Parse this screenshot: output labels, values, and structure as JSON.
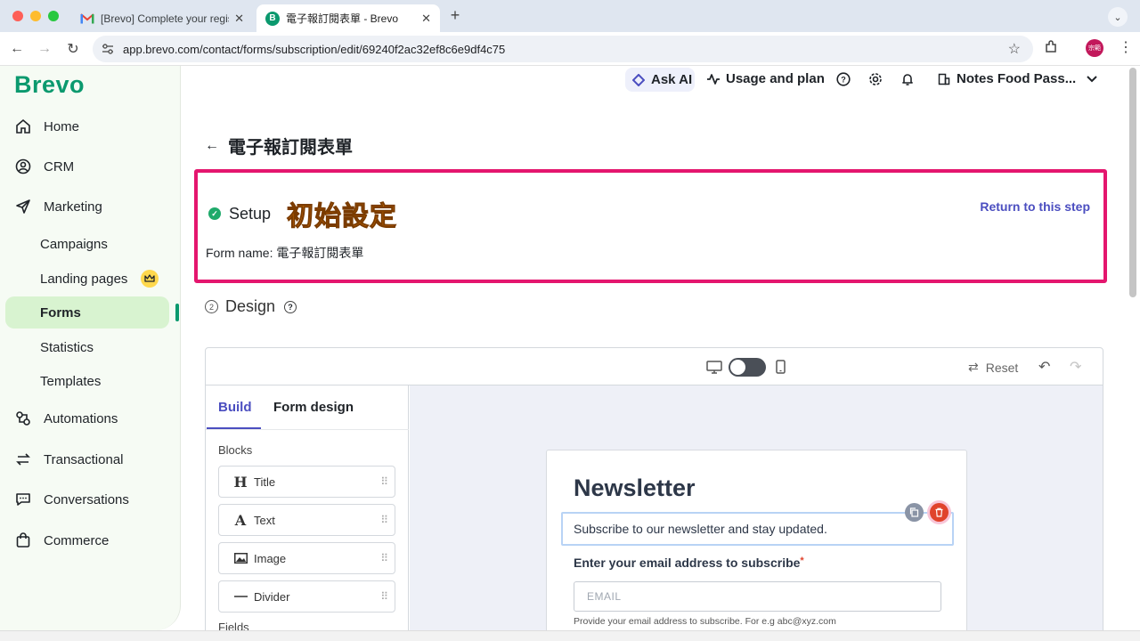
{
  "browser": {
    "tabs": [
      {
        "title": "[Brevo] Complete your registr",
        "favicon": "gmail-icon",
        "close": "✕"
      },
      {
        "title": "電子報訂閱表單 - Brevo",
        "favicon": "brevo-icon",
        "close": "✕"
      }
    ],
    "url": "app.brevo.com/contact/forms/subscription/edit/69240f2ac32ef8c6e9df4c75",
    "profile_initials": "宗範"
  },
  "colors": {
    "brand_green": "#0b996e",
    "accent_purple": "#4b4ec0",
    "highlight_box": "#e4166e",
    "annotation_orange": "#ff8a00"
  },
  "sidebar": {
    "logo": "Brevo",
    "items": [
      {
        "label": "Home",
        "icon": "home-icon"
      },
      {
        "label": "CRM",
        "icon": "contacts-icon"
      },
      {
        "label": "Marketing",
        "icon": "send-icon"
      },
      {
        "label": "Campaigns"
      },
      {
        "label": "Landing pages",
        "badge_icon": "crown-icon"
      },
      {
        "label": "Forms",
        "active": true
      },
      {
        "label": "Statistics"
      },
      {
        "label": "Templates"
      },
      {
        "label": "Automations",
        "icon": "automation-icon"
      },
      {
        "label": "Transactional",
        "icon": "transactional-icon"
      },
      {
        "label": "Conversations",
        "icon": "chat-icon"
      },
      {
        "label": "Commerce",
        "icon": "shop-icon"
      }
    ]
  },
  "header": {
    "ask_ai": "Ask AI",
    "usage": "Usage and plan",
    "account": "Notes Food Pass..."
  },
  "page": {
    "title": "電子報訂閱表單",
    "setup": {
      "label": "Setup",
      "annotation": "初始設定",
      "return_link": "Return to this step",
      "form_name_label": "Form name: ",
      "form_name_value": "電子報訂閱表單"
    },
    "design": {
      "step": "2",
      "label": "Design"
    }
  },
  "editor": {
    "reset_label": "Reset",
    "tabs": [
      "Build",
      "Form design"
    ],
    "blocks_label": "Blocks",
    "blocks": [
      {
        "label": "Title",
        "icon": "H"
      },
      {
        "label": "Text",
        "icon": "A"
      },
      {
        "label": "Image",
        "icon": "image-icon"
      },
      {
        "label": "Divider",
        "icon": "divider-icon"
      }
    ],
    "fields_label": "Fields",
    "preview": {
      "title": "Newsletter",
      "description": "Subscribe to our newsletter and stay updated.",
      "email_label": "Enter your email address to subscribe",
      "required_mark": "*",
      "email_placeholder": "EMAIL",
      "email_help": "Provide your email address to subscribe. For e.g abc@xyz.com"
    }
  }
}
